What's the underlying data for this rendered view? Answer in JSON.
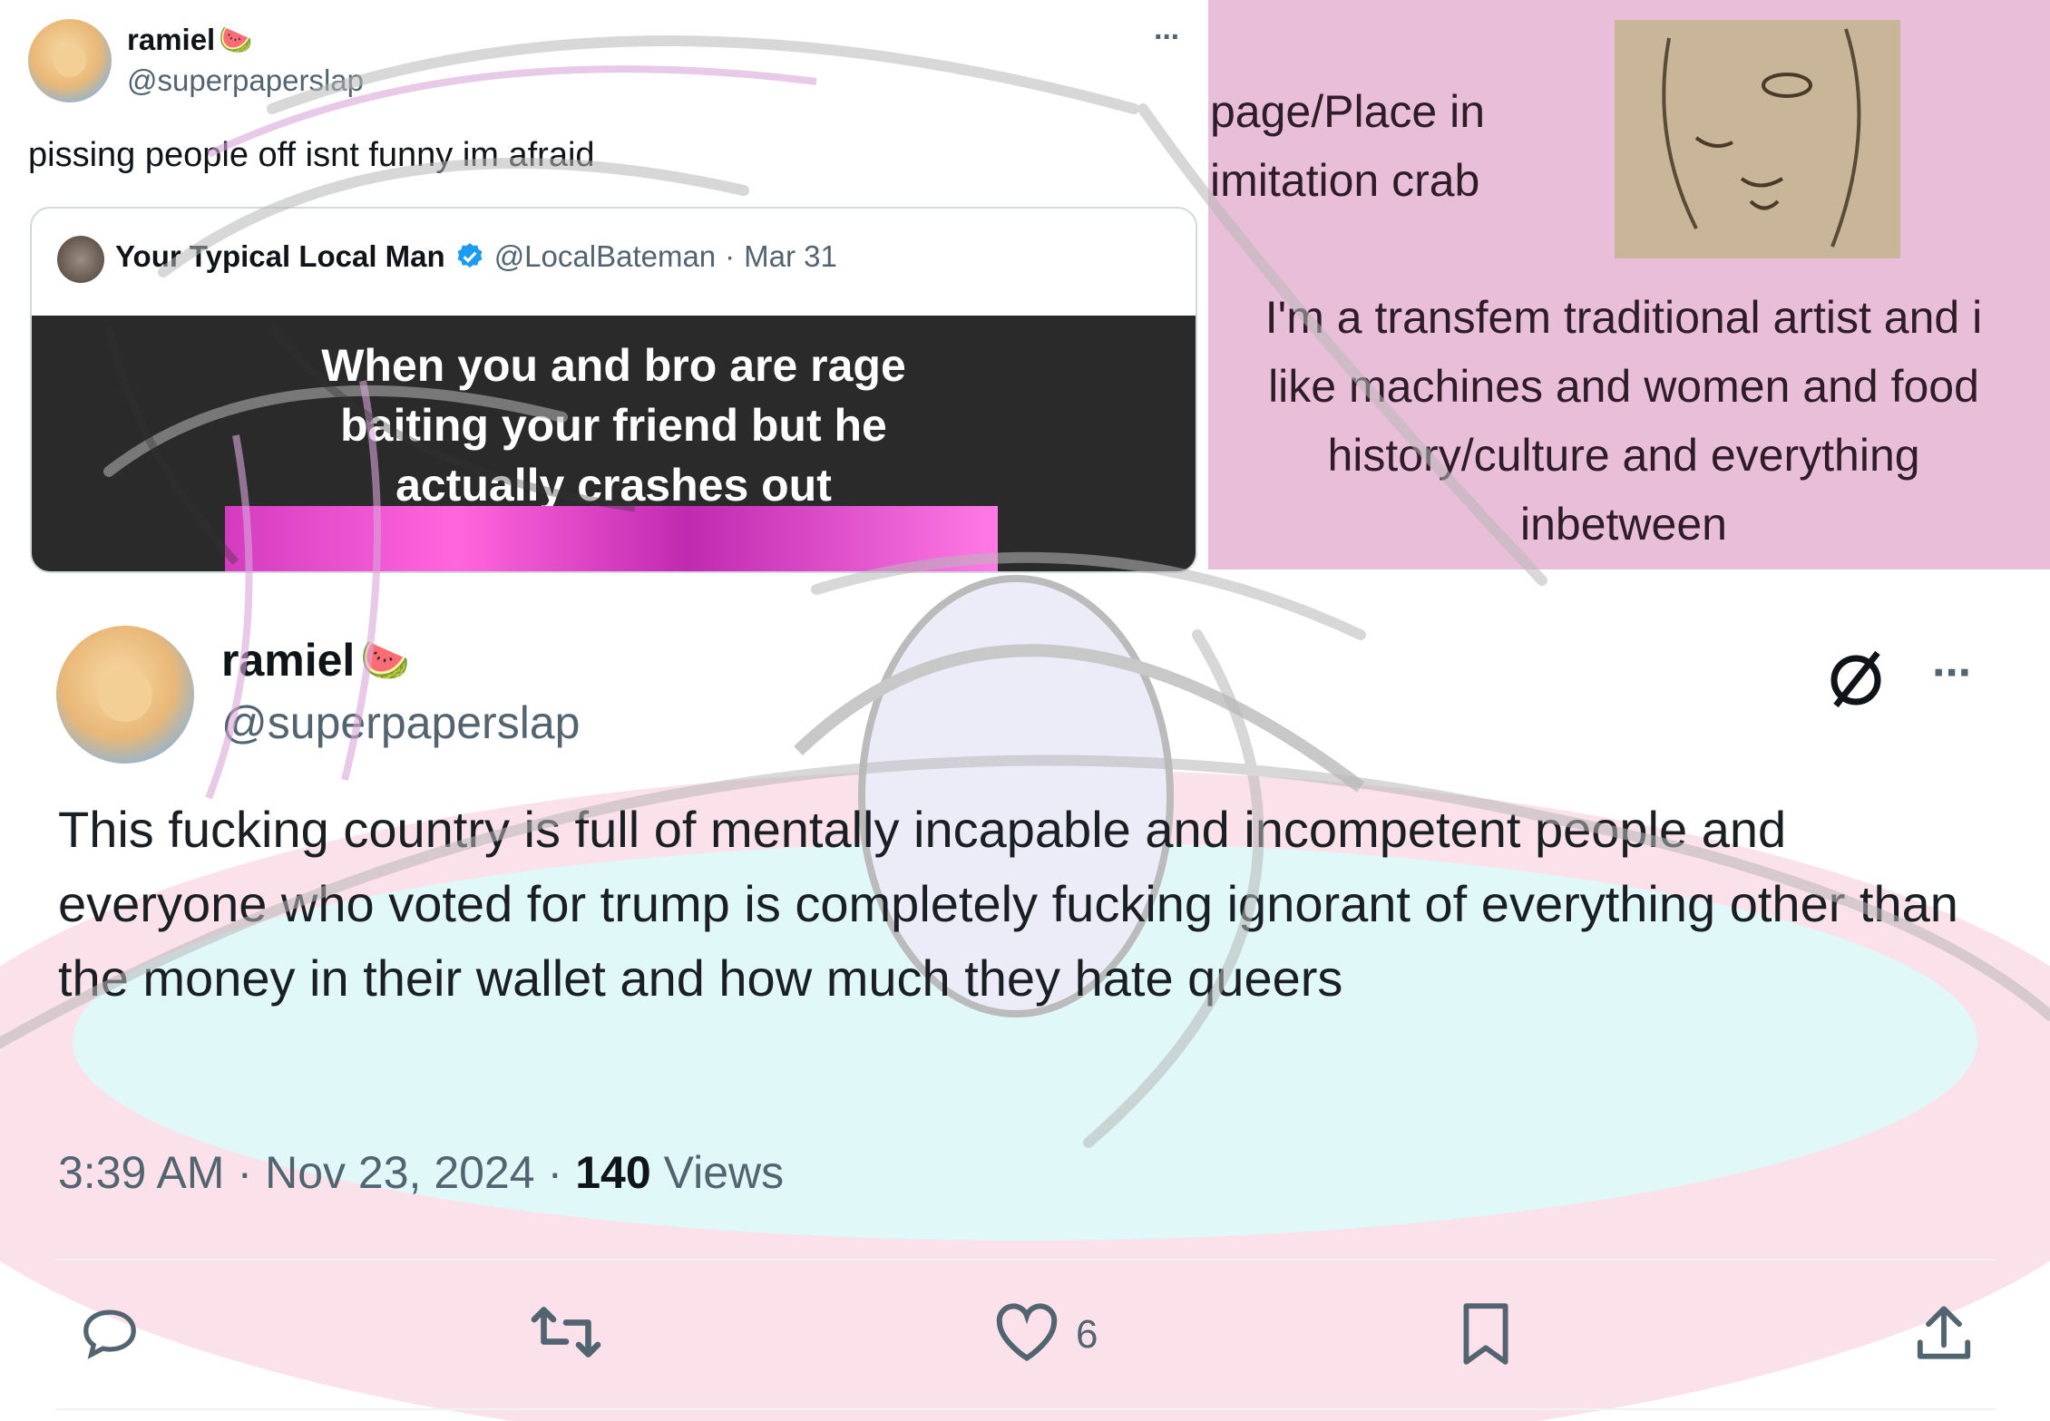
{
  "top_tweet": {
    "display_name": "ramiel",
    "name_emoji": "🍉",
    "handle": "@superpaperslap",
    "more_label": "···",
    "text": "pissing people off isnt funny im afraid",
    "quote": {
      "display_name": "Your Typical Local Man",
      "handle": "@LocalBateman",
      "separator": "·",
      "date": "Mar 31",
      "media_caption": "When you and bro are rage baiting your friend but he actually crashes out"
    }
  },
  "profile_bio": {
    "line1": "page/Place in",
    "line2": "imitation crab",
    "bio": "I'm a transfem traditional artist and i like machines and women and food history/culture and everything inbetween"
  },
  "main_tweet": {
    "display_name": "ramiel",
    "name_emoji": "🍉",
    "handle": "@superpaperslap",
    "grok_icon": "grok-slash-icon",
    "more_label": "···",
    "text": "This fucking country is full of mentally incapable and incompetent people and everyone who voted for trump is completely fucking ignorant of everything other than the money in their wallet and how much they hate queers",
    "time": "3:39 AM",
    "dot": "·",
    "date": "Nov 23, 2024",
    "views_count": "140",
    "views_label": "Views",
    "actions": {
      "reply_icon": "reply-icon",
      "retweet_icon": "retweet-icon",
      "like_icon": "heart-icon",
      "like_count": "6",
      "bookmark_icon": "bookmark-icon",
      "share_icon": "share-icon"
    }
  },
  "colors": {
    "bio_bg": "#e8bed8",
    "verified": "#1d9bf0",
    "secondary_text": "#536471",
    "overlay_pink": "#f7c6d8",
    "overlay_cyan": "#d8f7f7"
  }
}
